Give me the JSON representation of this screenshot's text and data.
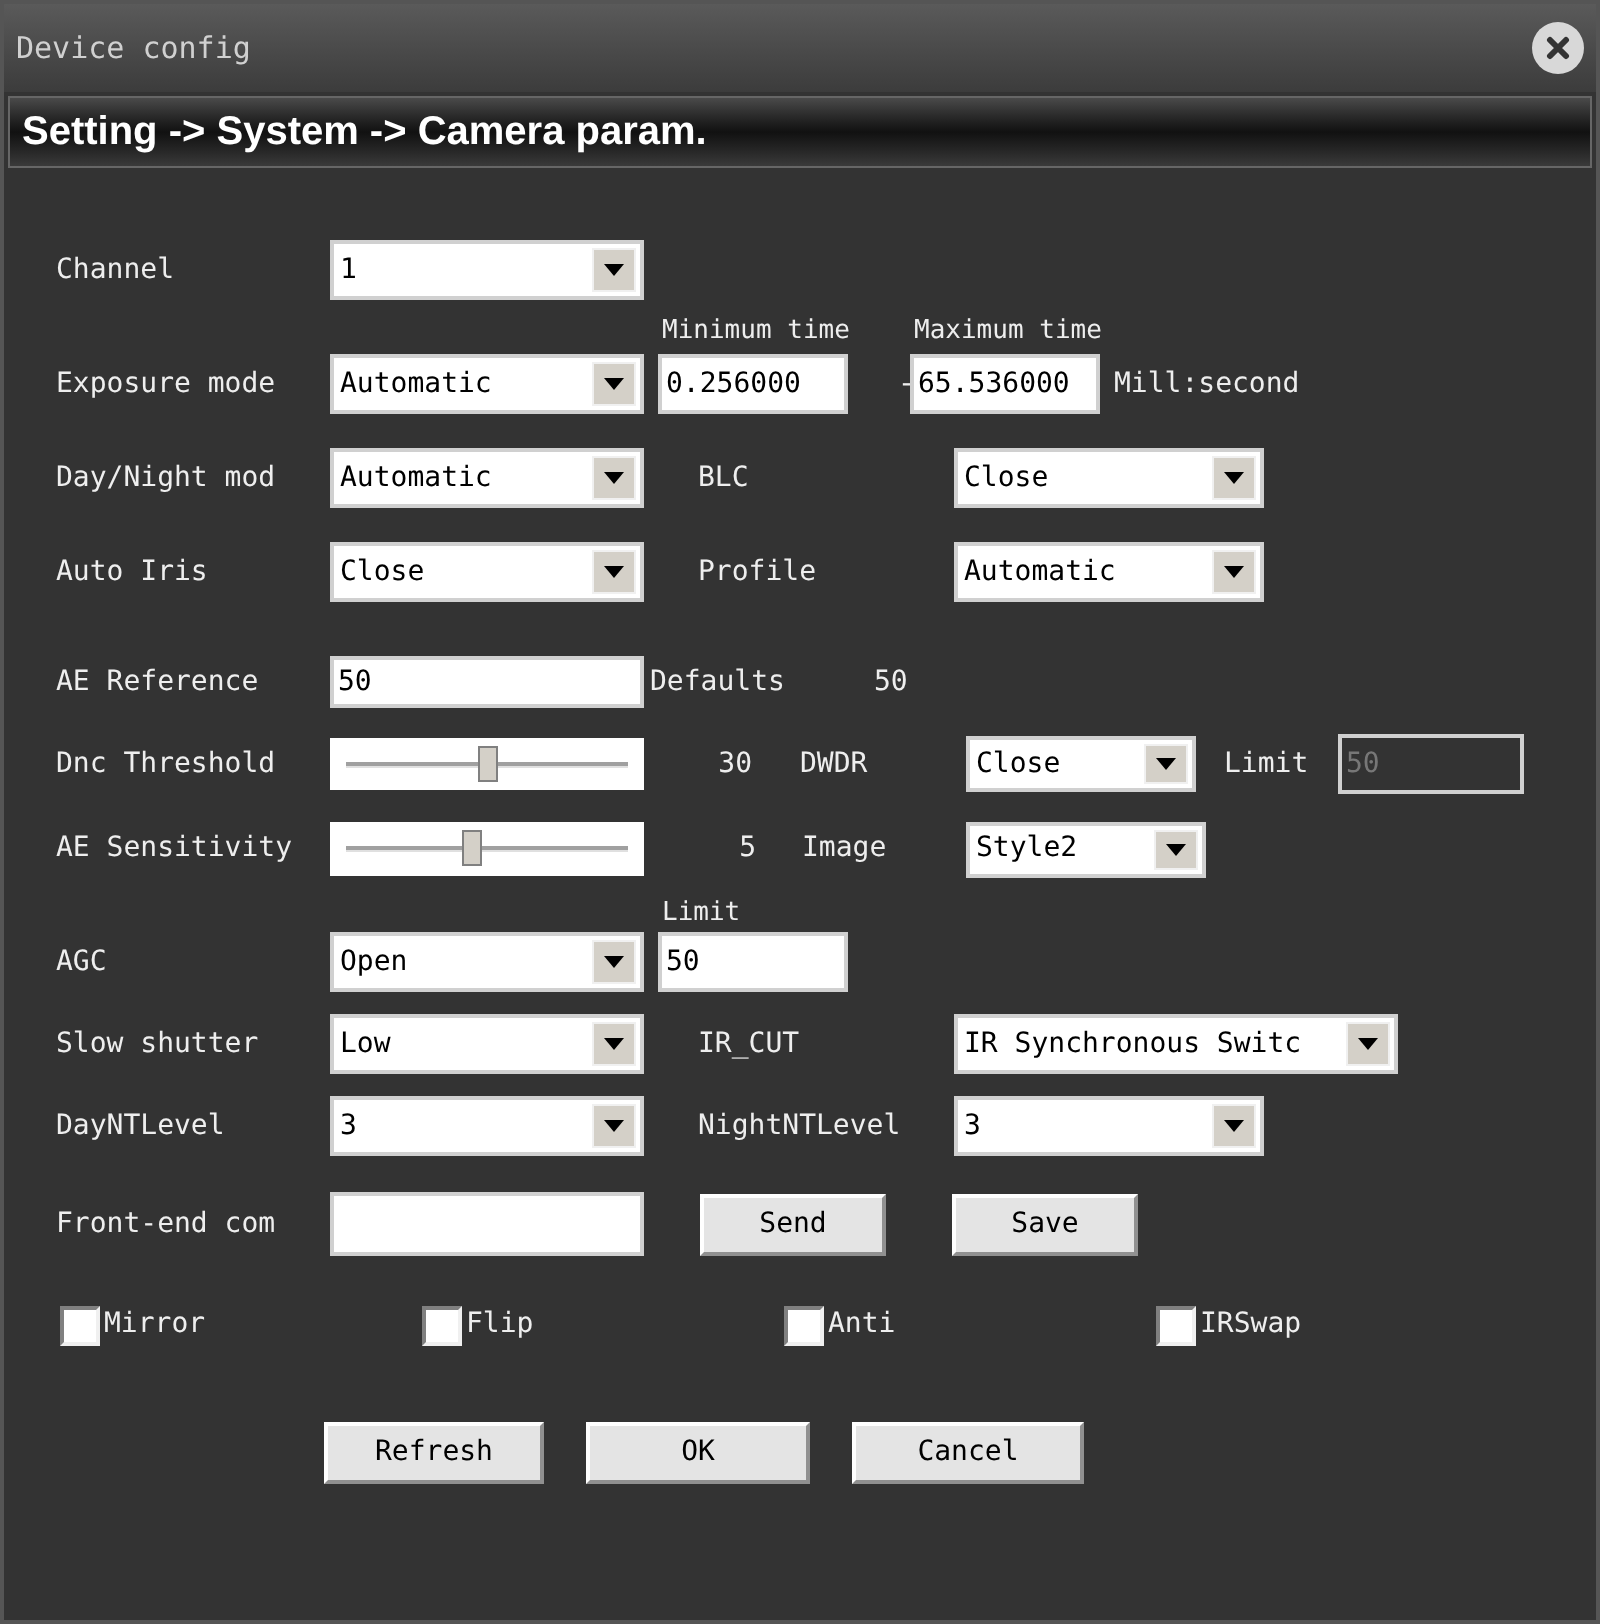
{
  "window": {
    "title": "Device config"
  },
  "breadcrumb": "Setting -> System -> Camera param.",
  "rows": [
    {
      "items": [
        {
          "kind": "label",
          "text": "Channel"
        },
        {
          "kind": "select",
          "value": "1"
        }
      ]
    },
    {
      "items": [
        {
          "kind": "caption",
          "text": "Minimum time"
        },
        {
          "kind": "caption",
          "text": "Maximum time"
        }
      ]
    },
    {
      "items": [
        {
          "kind": "label",
          "text": "Exposure mode"
        },
        {
          "kind": "select",
          "value": "Automatic"
        },
        {
          "kind": "input",
          "value": "0.256000"
        },
        {
          "kind": "value",
          "text": "-"
        },
        {
          "kind": "input",
          "value": "65.536000"
        },
        {
          "kind": "label",
          "text": "Mill:second"
        }
      ]
    },
    {
      "items": [
        {
          "kind": "label",
          "text": "Day/Night mod"
        },
        {
          "kind": "select",
          "value": "Automatic"
        },
        {
          "kind": "label",
          "text": "BLC"
        },
        {
          "kind": "select",
          "value": "Close"
        }
      ]
    },
    {
      "items": [
        {
          "kind": "label",
          "text": "Auto Iris"
        },
        {
          "kind": "select",
          "value": "Close"
        },
        {
          "kind": "label",
          "text": "Profile"
        },
        {
          "kind": "select",
          "value": "Automatic"
        }
      ]
    },
    {
      "items": [
        {
          "kind": "label",
          "text": "AE Reference"
        },
        {
          "kind": "input",
          "value": "50"
        },
        {
          "kind": "label",
          "text": "Defaults"
        },
        {
          "kind": "value",
          "text": "50"
        }
      ]
    },
    {
      "items": [
        {
          "kind": "label",
          "text": "Dnc Threshold"
        },
        {
          "kind": "slider",
          "level": 0.5
        },
        {
          "kind": "value",
          "text": "30"
        },
        {
          "kind": "label",
          "text": "DWDR"
        },
        {
          "kind": "select",
          "value": "Close"
        },
        {
          "kind": "label",
          "text": "Limit"
        },
        {
          "kind": "input",
          "value": "50",
          "disabled": true
        }
      ]
    },
    {
      "items": [
        {
          "kind": "label",
          "text": "AE Sensitivity"
        },
        {
          "kind": "slider",
          "level": 0.45
        },
        {
          "kind": "value",
          "text": "5"
        },
        {
          "kind": "label",
          "text": "Image"
        },
        {
          "kind": "select",
          "value": "Style2"
        }
      ]
    },
    {
      "items": [
        {
          "kind": "caption",
          "text": "Limit"
        }
      ]
    },
    {
      "items": [
        {
          "kind": "label",
          "text": "AGC"
        },
        {
          "kind": "select",
          "value": "Open"
        },
        {
          "kind": "input",
          "value": "50"
        }
      ]
    },
    {
      "items": [
        {
          "kind": "label",
          "text": "Slow shutter"
        },
        {
          "kind": "select",
          "value": "Low"
        },
        {
          "kind": "label",
          "text": "IR_CUT"
        },
        {
          "kind": "select",
          "value": "IR Synchronous Switc"
        }
      ]
    },
    {
      "items": [
        {
          "kind": "label",
          "text": "DayNTLevel"
        },
        {
          "kind": "select",
          "value": "3"
        },
        {
          "kind": "label",
          "text": "NightNTLevel"
        },
        {
          "kind": "select",
          "value": "3"
        }
      ]
    },
    {
      "items": [
        {
          "kind": "label",
          "text": "Front-end com"
        },
        {
          "kind": "input"
        },
        {
          "kind": "button",
          "text": "Send"
        },
        {
          "kind": "button",
          "text": "Save"
        }
      ]
    },
    {
      "items": [
        {
          "kind": "checkbox",
          "text": "Mirror",
          "checked": false
        },
        {
          "kind": "checkbox",
          "text": "Flip",
          "checked": false
        },
        {
          "kind": "checkbox",
          "text": "Anti",
          "checked": false
        },
        {
          "kind": "checkbox",
          "text": "IRSwap",
          "checked": false
        }
      ]
    },
    {
      "items": [
        {
          "kind": "button",
          "text": "Refresh"
        },
        {
          "kind": "button",
          "text": "OK"
        },
        {
          "kind": "button",
          "text": "Cancel"
        }
      ]
    }
  ]
}
